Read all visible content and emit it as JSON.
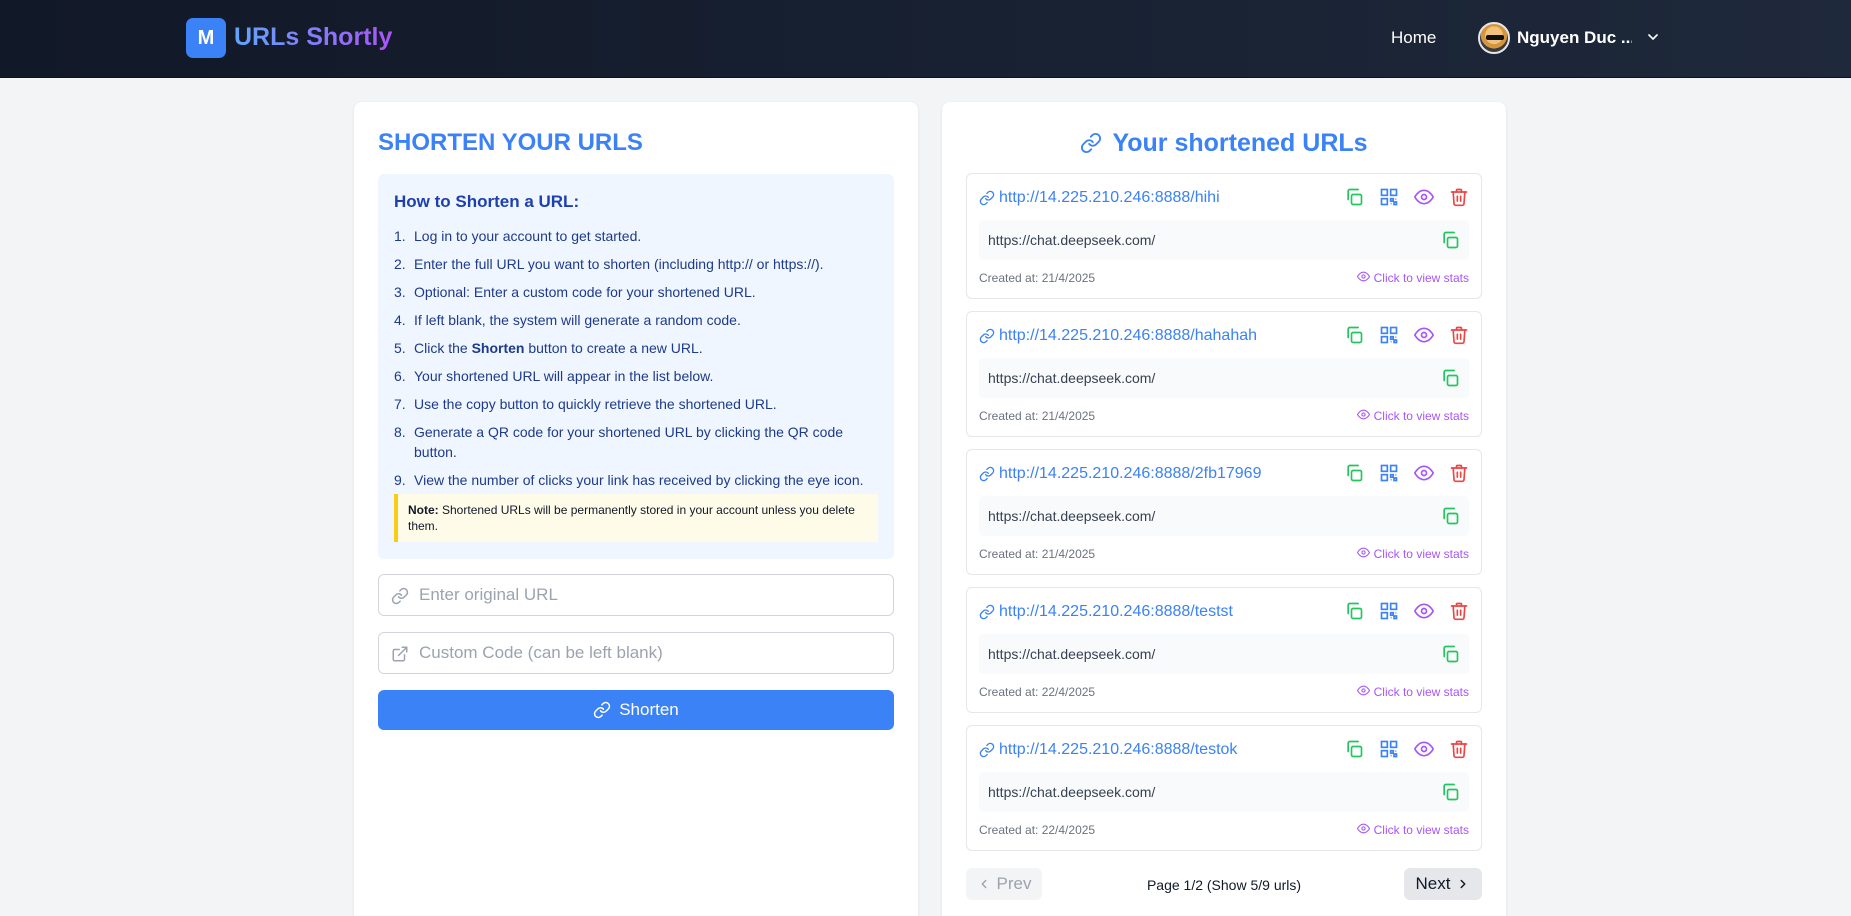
{
  "header": {
    "logo_letter": "M",
    "brand": "URLs Shortly",
    "nav_home": "Home",
    "user_name": "Nguyen Duc ..."
  },
  "left": {
    "title": "SHORTEN YOUR URLS",
    "howto_title": "How to Shorten a URL:",
    "steps": [
      {
        "num": "1.",
        "text": "Log in to your account to get started."
      },
      {
        "num": "2.",
        "text": "Enter the full URL you want to shorten (including http:// or https://)."
      },
      {
        "num": "3.",
        "text": "Optional: Enter a custom code for your shortened URL."
      },
      {
        "num": "4.",
        "text": "If left blank, the system will generate a random code."
      },
      {
        "num": "5.",
        "pre": "Click the ",
        "bold": "Shorten",
        "post": " button to create a new URL."
      },
      {
        "num": "6.",
        "text": "Your shortened URL will appear in the list below."
      },
      {
        "num": "7.",
        "text": "Use the copy button to quickly retrieve the shortened URL."
      },
      {
        "num": "8.",
        "text": "Generate a QR code for your shortened URL by clicking the QR code button."
      },
      {
        "num": "9.",
        "text": "View the number of clicks your link has received by clicking the eye icon."
      }
    ],
    "note_label": "Note:",
    "note_text": " Shortened URLs will be permanently stored in your account unless you delete them.",
    "url_placeholder": "Enter original URL",
    "code_placeholder": "Custom Code (can be left blank)",
    "shorten_label": "Shorten"
  },
  "right": {
    "title": "Your shortened URLs",
    "items": [
      {
        "short": "http://14.225.210.246:8888/hihi",
        "original": "https://chat.deepseek.com/",
        "created": "Created at: 21/4/2025",
        "stats": "Click to view stats"
      },
      {
        "short": "http://14.225.210.246:8888/hahahah",
        "original": "https://chat.deepseek.com/",
        "created": "Created at: 21/4/2025",
        "stats": "Click to view stats"
      },
      {
        "short": "http://14.225.210.246:8888/2fb17969",
        "original": "https://chat.deepseek.com/",
        "created": "Created at: 21/4/2025",
        "stats": "Click to view stats"
      },
      {
        "short": "http://14.225.210.246:8888/testst",
        "original": "https://chat.deepseek.com/",
        "created": "Created at: 22/4/2025",
        "stats": "Click to view stats"
      },
      {
        "short": "http://14.225.210.246:8888/testok",
        "original": "https://chat.deepseek.com/",
        "created": "Created at: 22/4/2025",
        "stats": "Click to view stats"
      }
    ],
    "prev_label": "Prev",
    "next_label": "Next",
    "page_info": "Page 1/2 (Show 5/9 urls)"
  },
  "colors": {
    "accent": "#3b82f6",
    "copy": "#22c55e",
    "view": "#a855f7",
    "delete": "#ef4444",
    "header_bg": "#111827"
  }
}
